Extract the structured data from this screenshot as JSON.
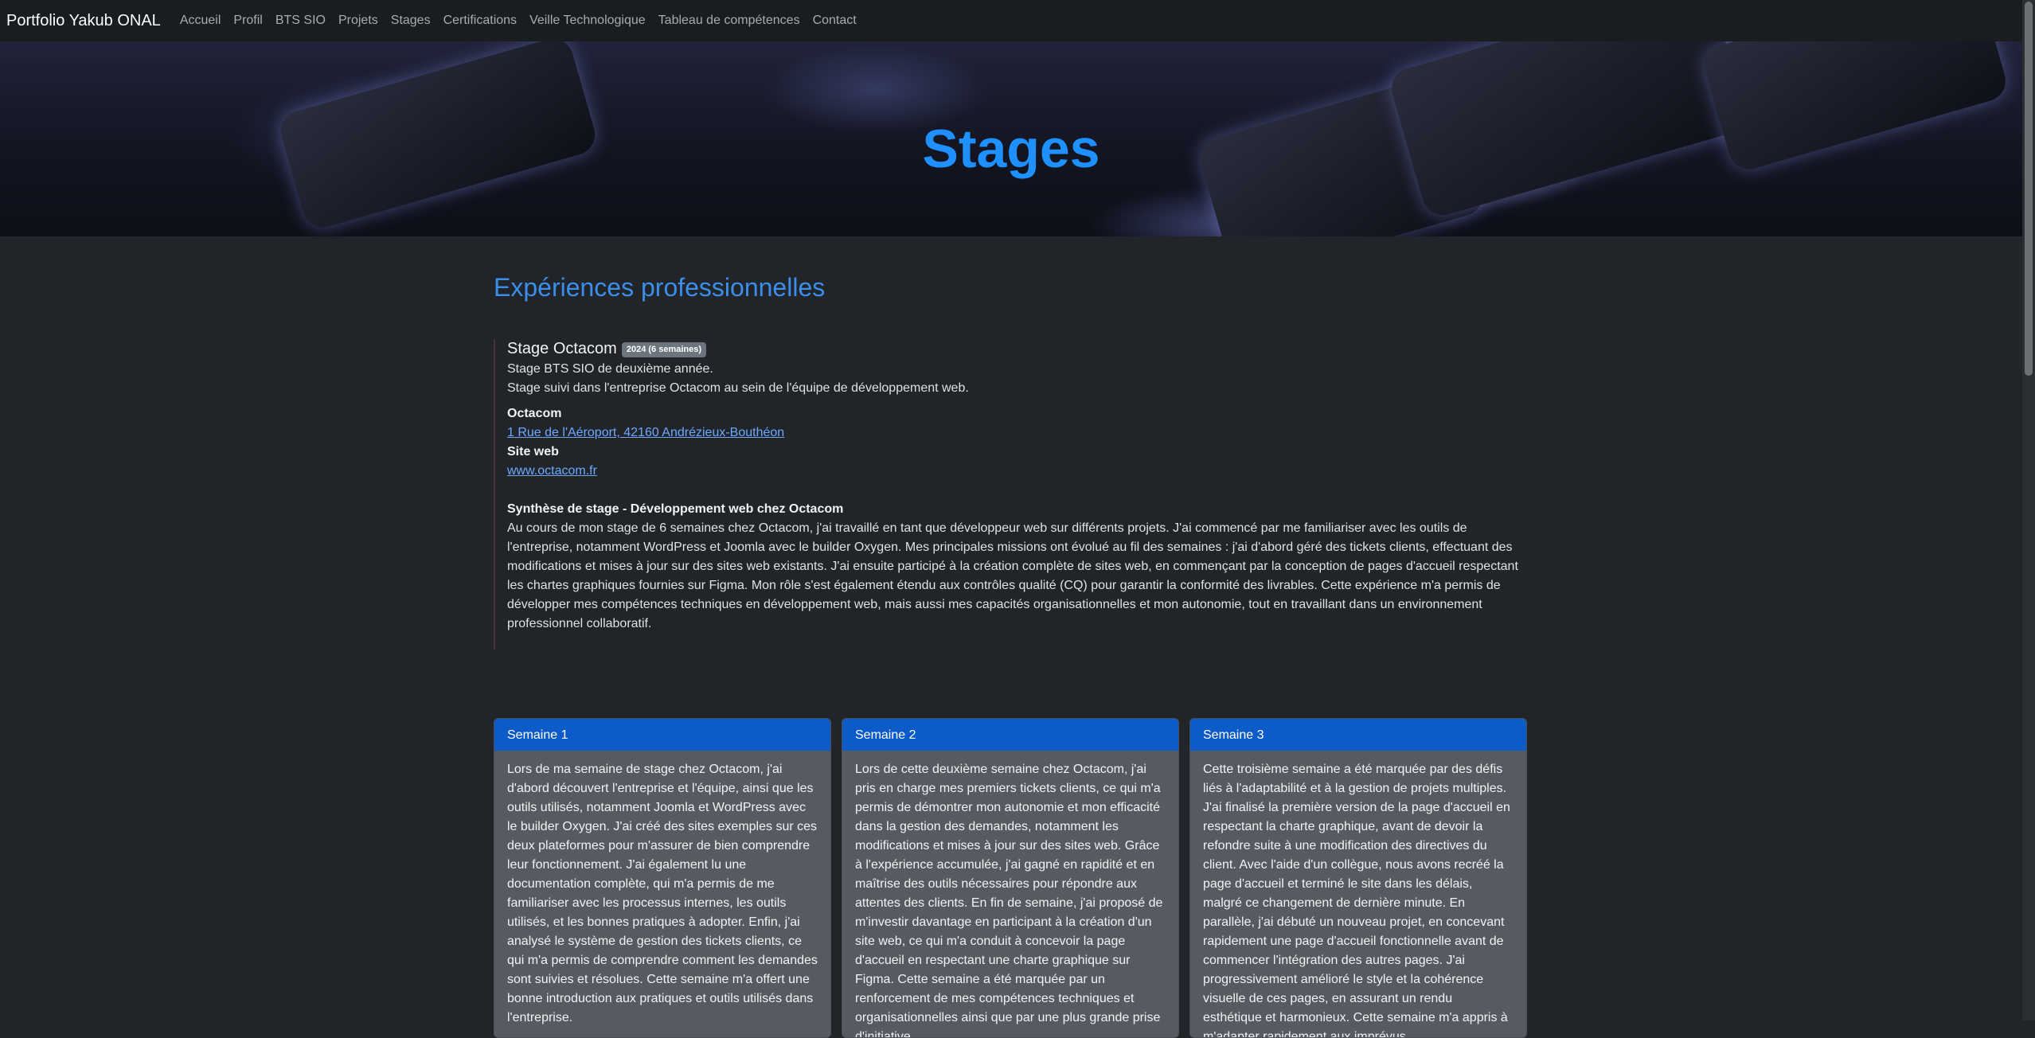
{
  "nav": {
    "brand": "Portfolio Yakub ONAL",
    "links": [
      "Accueil",
      "Profil",
      "BTS SIO",
      "Projets",
      "Stages",
      "Certifications",
      "Veille Technologique",
      "Tableau de compétences",
      "Contact"
    ]
  },
  "hero": {
    "title": "Stages"
  },
  "main": {
    "section_title": "Expériences professionnelles",
    "stage": {
      "name": "Stage Octacom",
      "badge": "2024 (6 semaines)",
      "desc1": "Stage BTS SIO de deuxième année.",
      "desc2": "Stage suivi dans l'entreprise Octacom au sein de l'équipe de développement web.",
      "company": "Octacom",
      "address": "1 Rue de l'Aéroport, 42160 Andrézieux-Bouthéon",
      "site_label": "Site web",
      "site_url": "www.octacom.fr",
      "synthese_title": "Synthèse de stage - Développement web chez Octacom",
      "synthese_text": "Au cours de mon stage de 6 semaines chez Octacom, j'ai travaillé en tant que développeur web sur différents projets. J'ai commencé par me familiariser avec les outils de l'entreprise, notamment WordPress et Joomla avec le builder Oxygen. Mes principales missions ont évolué au fil des semaines : j'ai d'abord géré des tickets clients, effectuant des modifications et mises à jour sur des sites web existants. J'ai ensuite participé à la création complète de sites web, en commençant par la conception de pages d'accueil respectant les chartes graphiques fournies sur Figma. Mon rôle s'est également étendu aux contrôles qualité (CQ) pour garantir la conformité des livrables. Cette expérience m'a permis de développer mes compétences techniques en développement web, mais aussi mes capacités organisationnelles et mon autonomie, tout en travaillant dans un environnement professionnel collaboratif."
    },
    "weeks": [
      {
        "title": "Semaine 1",
        "text": "Lors de ma semaine de stage chez Octacom, j'ai d'abord découvert l'entreprise et l'équipe, ainsi que les outils utilisés, notamment Joomla et WordPress avec le builder Oxygen. J'ai créé des sites exemples sur ces deux plateformes pour m'assurer de bien comprendre leur fonctionnement. J'ai également lu une documentation complète, qui m'a permis de me familiariser avec les processus internes, les outils utilisés, et les bonnes pratiques à adopter. Enfin, j'ai analysé le système de gestion des tickets clients, ce qui m'a permis de comprendre comment les demandes sont suivies et résolues. Cette semaine m'a offert une bonne introduction aux pratiques et outils utilisés dans l'entreprise."
      },
      {
        "title": "Semaine 2",
        "text": "Lors de cette deuxième semaine chez Octacom, j'ai pris en charge mes premiers tickets clients, ce qui m'a permis de démontrer mon autonomie et mon efficacité dans la gestion des demandes, notamment les modifications et mises à jour sur des sites web. Grâce à l'expérience accumulée, j'ai gagné en rapidité et en maîtrise des outils nécessaires pour répondre aux attentes des clients. En fin de semaine, j'ai proposé de m'investir davantage en participant à la création d'un site web, ce qui m'a conduit à concevoir la page d'accueil en respectant une charte graphique sur Figma. Cette semaine a été marquée par un renforcement de mes compétences techniques et organisationnelles ainsi que par une plus grande prise d'initiative."
      },
      {
        "title": "Semaine 3",
        "text": "Cette troisième semaine a été marquée par des défis liés à l'adaptabilité et à la gestion de projets multiples. J'ai finalisé la première version de la page d'accueil en respectant la charte graphique, avant de devoir la refondre suite à une modification des directives du client. Avec l'aide d'un collègue, nous avons recréé la page d'accueil et terminé le site dans les délais, malgré ce changement de dernière minute. En parallèle, j'ai débuté un nouveau projet, en concevant rapidement une page d'accueil fonctionnelle avant de commencer l'intégration des autres pages. J'ai progressivement amélioré le style et la cohérence visuelle de ces pages, en assurant un rendu esthétique et harmonieux. Cette semaine m'a appris à m'adapter rapidement aux imprévus."
      }
    ]
  }
}
